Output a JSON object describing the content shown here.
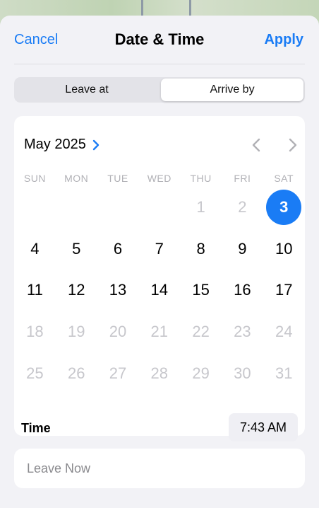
{
  "nav": {
    "cancel_label": "Cancel",
    "title": "Date & Time",
    "apply_label": "Apply"
  },
  "segment": {
    "options": [
      "Leave at",
      "Arrive by"
    ],
    "selected": "Arrive by"
  },
  "calendar": {
    "month_label": "May 2025",
    "weekdays": [
      "SUN",
      "MON",
      "TUE",
      "WED",
      "THU",
      "FRI",
      "SAT"
    ],
    "weeks": [
      [
        {
          "day": ""
        },
        {
          "day": ""
        },
        {
          "day": ""
        },
        {
          "day": ""
        },
        {
          "day": "1",
          "state": "disabled"
        },
        {
          "day": "2",
          "state": "disabled"
        },
        {
          "day": "3",
          "state": "selected"
        }
      ],
      [
        {
          "day": "4"
        },
        {
          "day": "5"
        },
        {
          "day": "6"
        },
        {
          "day": "7"
        },
        {
          "day": "8"
        },
        {
          "day": "9"
        },
        {
          "day": "10"
        }
      ],
      [
        {
          "day": "11"
        },
        {
          "day": "12"
        },
        {
          "day": "13"
        },
        {
          "day": "14"
        },
        {
          "day": "15"
        },
        {
          "day": "16"
        },
        {
          "day": "17"
        }
      ],
      [
        {
          "day": "18",
          "state": "disabled"
        },
        {
          "day": "19",
          "state": "disabled"
        },
        {
          "day": "20",
          "state": "disabled"
        },
        {
          "day": "21",
          "state": "disabled"
        },
        {
          "day": "22",
          "state": "disabled"
        },
        {
          "day": "23",
          "state": "disabled"
        },
        {
          "day": "24",
          "state": "disabled"
        }
      ],
      [
        {
          "day": "25",
          "state": "disabled"
        },
        {
          "day": "26",
          "state": "disabled"
        },
        {
          "day": "27",
          "state": "disabled"
        },
        {
          "day": "28",
          "state": "disabled"
        },
        {
          "day": "29",
          "state": "disabled"
        },
        {
          "day": "30",
          "state": "disabled"
        },
        {
          "day": "31",
          "state": "disabled"
        }
      ]
    ],
    "prev_icon": "chevron-left-icon",
    "next_icon": "chevron-right-icon",
    "month_chevron_icon": "chevron-right-icon"
  },
  "time": {
    "label": "Time",
    "value": "7:43 AM"
  },
  "leave_now": {
    "label": "Leave Now"
  },
  "colors": {
    "accent": "#1a7cf5",
    "disabled_text": "#c7c7cc",
    "weekday_text": "#b1b1b6",
    "sheet_bg": "#f2f2f6"
  }
}
